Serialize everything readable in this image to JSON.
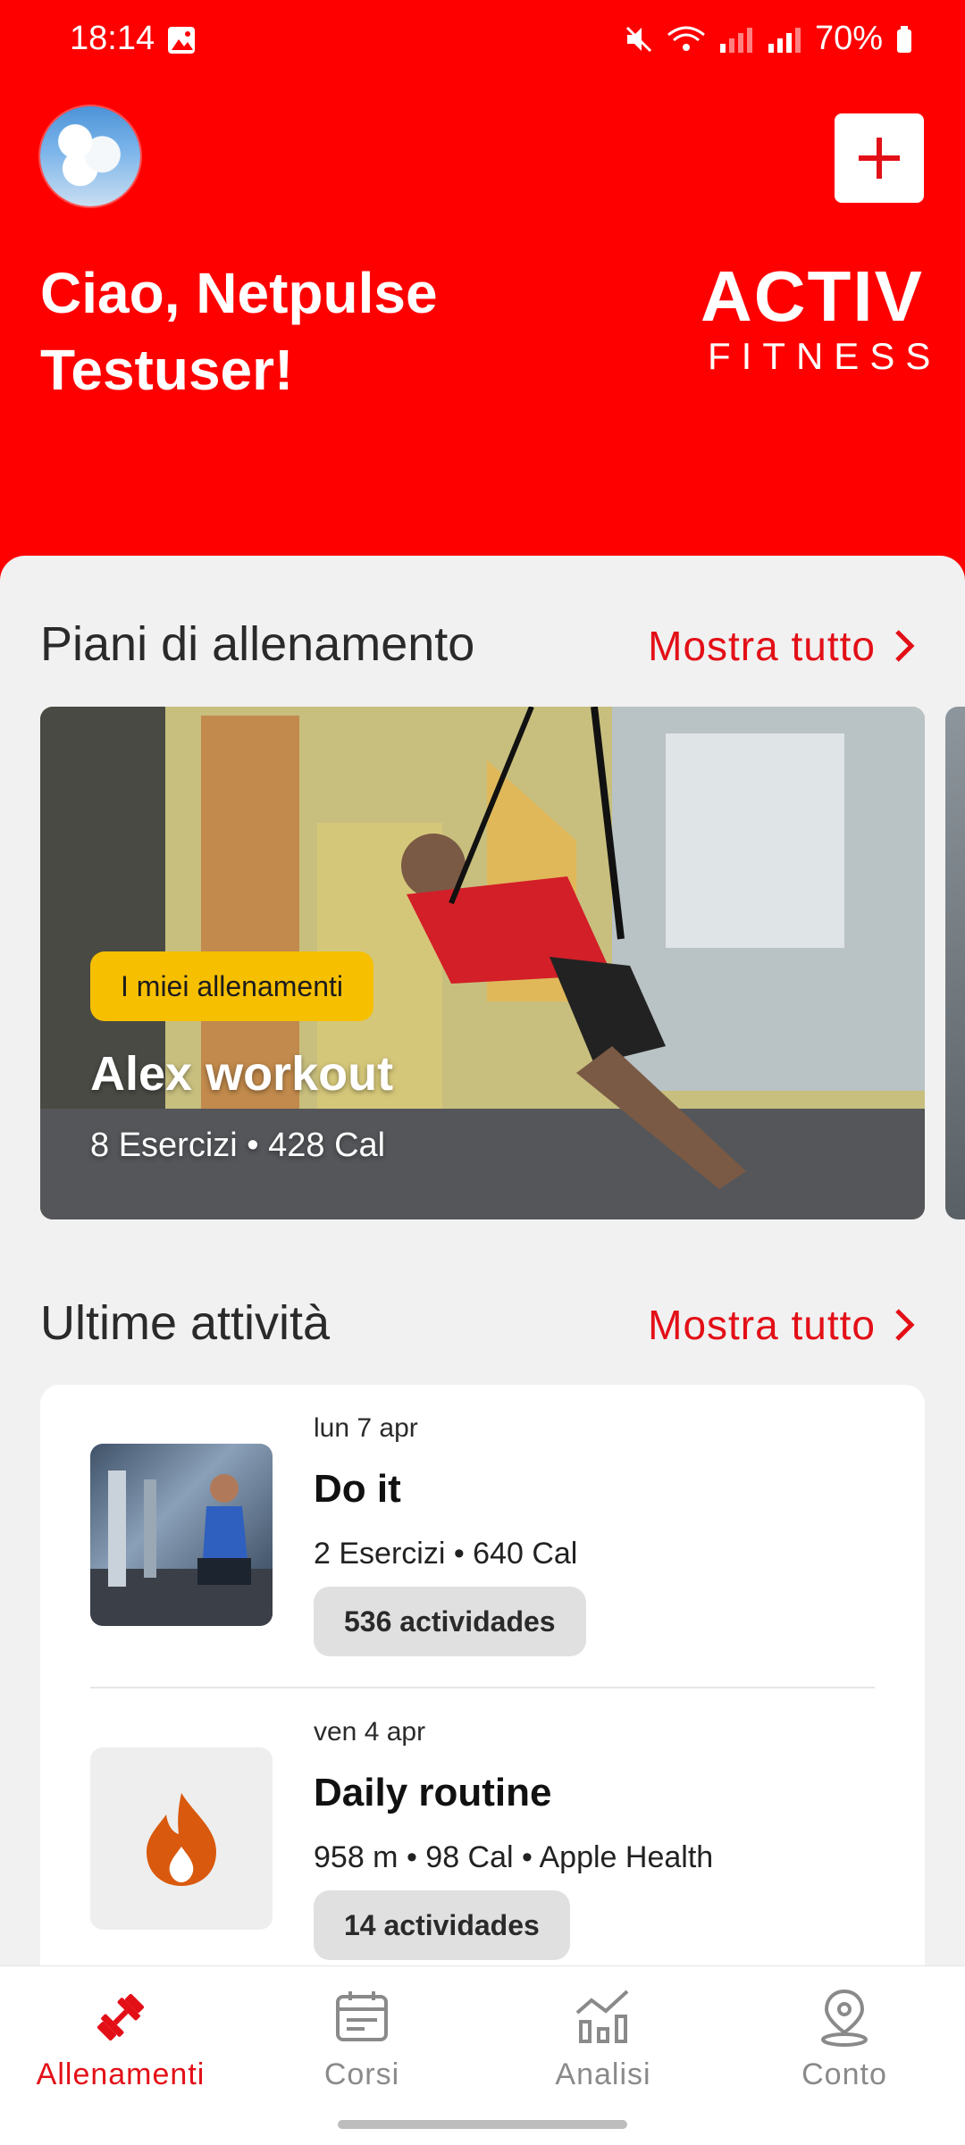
{
  "status_bar": {
    "time": "18:14",
    "battery": "70%"
  },
  "header": {
    "greeting": "Ciao, Netpulse Testuser!",
    "logo_top": "ACTIV",
    "logo_bottom": "FITNESS",
    "accent_color": "#ff0000"
  },
  "plans": {
    "title": "Piani di allenamento",
    "show_all": "Mostra tutto",
    "card": {
      "badge": "I miei allenamenti",
      "title": "Alex workout",
      "meta": "8 Esercizi • 428 Cal"
    }
  },
  "activities": {
    "title": "Ultime attività",
    "show_all": "Mostra tutto",
    "items": [
      {
        "date": "lun 7 apr",
        "name": "Do it",
        "meta": "2 Esercizi • 640 Cal",
        "pill": "536 actividades",
        "icon": "gym-photo"
      },
      {
        "date": "ven 4 apr",
        "name": "Daily routine",
        "meta": "958 m • 98 Cal • Apple Health",
        "pill": "14 actividades",
        "icon": "flame-icon"
      }
    ]
  },
  "nav": {
    "items": [
      {
        "label": "Allenamenti",
        "icon": "dumbbell-icon",
        "active": true
      },
      {
        "label": "Corsi",
        "icon": "calendar-icon",
        "active": false
      },
      {
        "label": "Analisi",
        "icon": "chart-icon",
        "active": false
      },
      {
        "label": "Conto",
        "icon": "location-pin-icon",
        "active": false
      }
    ]
  }
}
